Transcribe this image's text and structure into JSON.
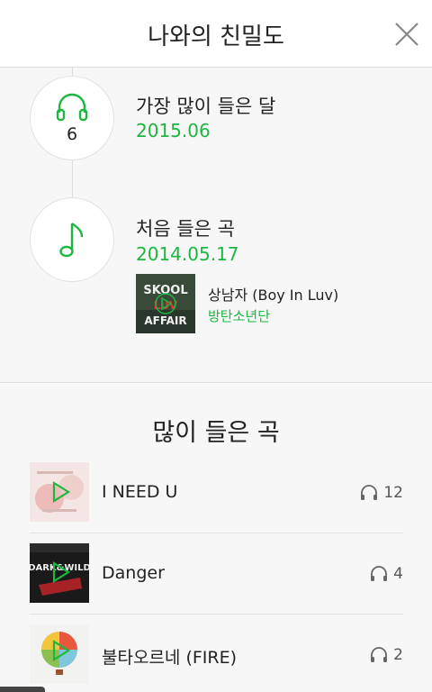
{
  "header": {
    "title": "나와의 친밀도",
    "close_icon": "close-icon"
  },
  "timeline": {
    "most_listened": {
      "icon": "headphones-icon",
      "count": "6",
      "label": "가장 많이 들은 달",
      "value": "2015.06"
    },
    "first_listened": {
      "icon": "music-note-icon",
      "label": "처음 들은 곡",
      "value": "2014.05.17",
      "song": {
        "title": "상남자 (Boy In Luv)",
        "artist": "방탄소년단",
        "cover_icon": "album-cover-skool-luv-affair"
      }
    }
  },
  "top_songs": {
    "title": "많이 들은 곡",
    "items": [
      {
        "title": "I NEED U",
        "count": "12",
        "cover_icon": "album-cover-i-need-u"
      },
      {
        "title": "Danger",
        "count": "4",
        "cover_icon": "album-cover-dark-and-wild"
      },
      {
        "title": "불타오르네 (FIRE)",
        "count": "2",
        "cover_icon": "album-cover-fire"
      }
    ]
  },
  "colors": {
    "accent": "#1cb640",
    "text": "#222222",
    "background": "#f7f7f7",
    "divider": "#dcdcdc"
  }
}
